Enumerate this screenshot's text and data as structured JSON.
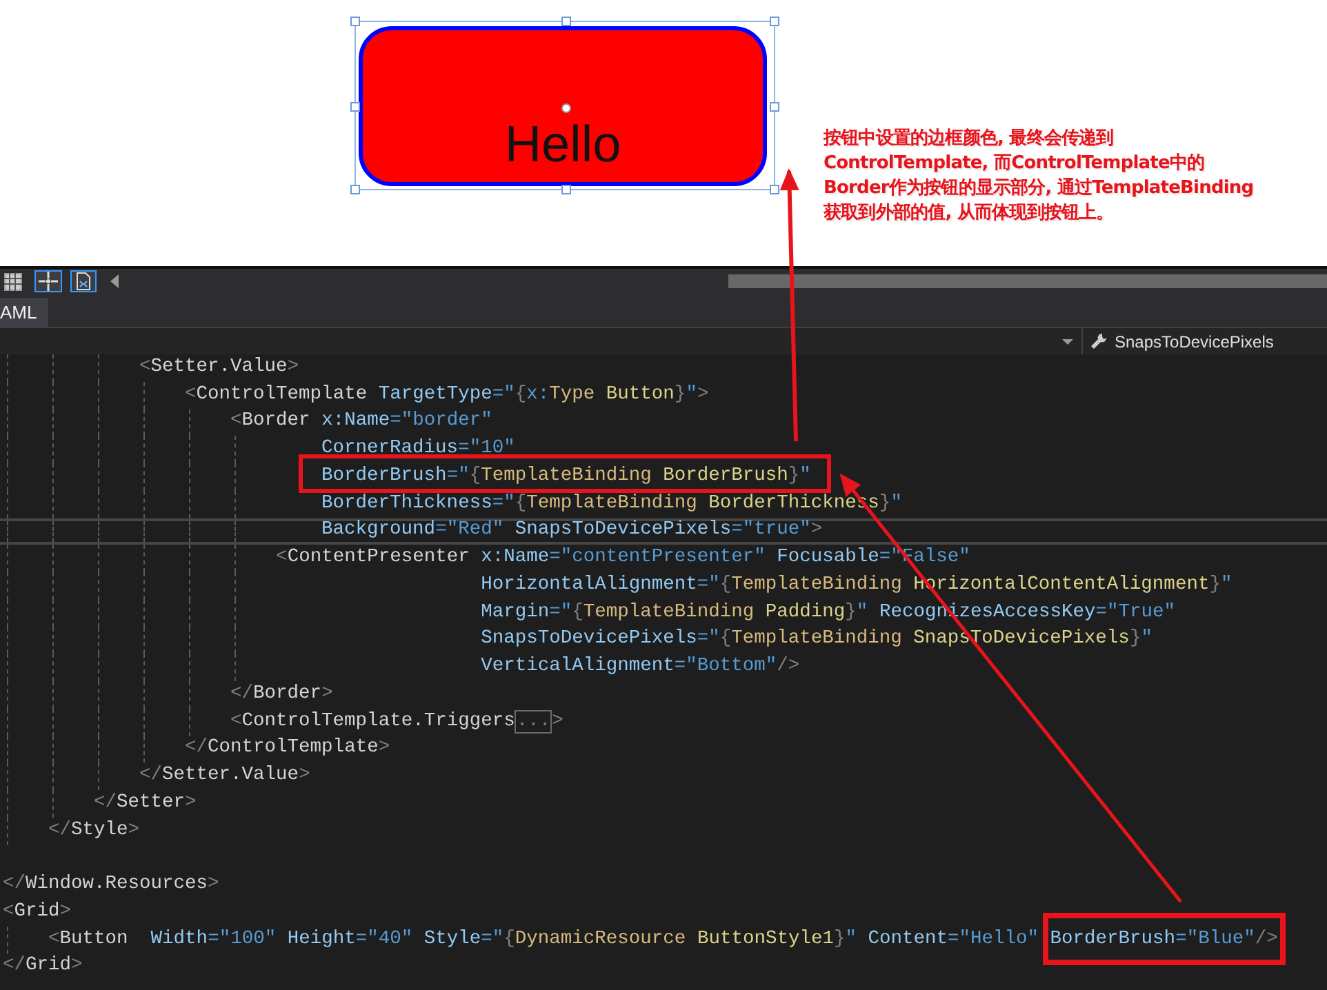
{
  "designer": {
    "button_content": "Hello",
    "note_lines": [
      "按钮中设置的边框颜色, 最终会传递到",
      "ControlTemplate, 而ControlTemplate中的",
      "Border作为按钮的显示部分, 通过TemplateBinding",
      "获取到外部的值, 从而体现到按钮上。"
    ]
  },
  "toolbar": {
    "tools": [
      {
        "kind": "grid",
        "on": false
      },
      {
        "kind": "snap",
        "on": true
      },
      {
        "kind": "page",
        "on": true
      }
    ]
  },
  "tabs": [
    {
      "label": "AML",
      "selected": true
    }
  ],
  "navbar": {
    "member": "SnapsToDevicePixels"
  },
  "code_lines": [
    {
      "kind": "code",
      "tokens": [
        {
          "kind": "punct",
          "text": "            <"
        },
        {
          "kind": "tag",
          "text": "Setter.Value"
        },
        {
          "kind": "punct",
          "text": ">"
        }
      ]
    },
    {
      "kind": "code",
      "tokens": [
        {
          "kind": "punct",
          "text": "                <"
        },
        {
          "kind": "tag",
          "text": "ControlTemplate"
        },
        {
          "kind": "attr",
          "text": " TargetType"
        },
        {
          "kind": "str",
          "text": "=\""
        },
        {
          "kind": "punct",
          "text": "{"
        },
        {
          "kind": "str",
          "text": "x:"
        },
        {
          "kind": "ext",
          "text": "Type"
        },
        {
          "kind": "arg",
          "text": " Button"
        },
        {
          "kind": "punct",
          "text": "}"
        },
        {
          "kind": "str",
          "text": "\""
        },
        {
          "kind": "punct",
          "text": ">"
        }
      ]
    },
    {
      "kind": "code",
      "tokens": [
        {
          "kind": "punct",
          "text": "                    <"
        },
        {
          "kind": "tag",
          "text": "Border"
        },
        {
          "kind": "attr",
          "text": " x:Name"
        },
        {
          "kind": "str",
          "text": "=\"border\""
        }
      ]
    },
    {
      "kind": "code",
      "tokens": [
        {
          "kind": "attr",
          "text": "                            CornerRadius"
        },
        {
          "kind": "str",
          "text": "=\"10\""
        }
      ]
    },
    {
      "kind": "code",
      "tokens": [
        {
          "kind": "attr",
          "text": "                            BorderBrush"
        },
        {
          "kind": "str",
          "text": "=\""
        },
        {
          "kind": "punct",
          "text": "{"
        },
        {
          "kind": "ext",
          "text": "TemplateBinding"
        },
        {
          "kind": "arg",
          "text": " BorderBrush"
        },
        {
          "kind": "punct",
          "text": "}"
        },
        {
          "kind": "str",
          "text": "\""
        }
      ]
    },
    {
      "kind": "code",
      "tokens": [
        {
          "kind": "attr",
          "text": "                            BorderThickness"
        },
        {
          "kind": "str",
          "text": "=\""
        },
        {
          "kind": "punct",
          "text": "{"
        },
        {
          "kind": "ext",
          "text": "TemplateBinding"
        },
        {
          "kind": "arg",
          "text": " BorderThickness"
        },
        {
          "kind": "punct",
          "text": "}"
        },
        {
          "kind": "str",
          "text": "\""
        }
      ]
    },
    {
      "kind": "current",
      "tokens": [
        {
          "kind": "attr",
          "text": "                            Background"
        },
        {
          "kind": "str",
          "text": "=\"Red\""
        },
        {
          "kind": "attr",
          "text": " SnapsToDevicePixels"
        },
        {
          "kind": "str",
          "text": "=\"true\""
        },
        {
          "kind": "punct",
          "text": ">"
        }
      ]
    },
    {
      "kind": "code",
      "tokens": [
        {
          "kind": "punct",
          "text": "                        <"
        },
        {
          "kind": "tag",
          "text": "ContentPresenter"
        },
        {
          "kind": "attr",
          "text": " x:Name"
        },
        {
          "kind": "str",
          "text": "=\"contentPresenter\""
        },
        {
          "kind": "attr",
          "text": " Focusable"
        },
        {
          "kind": "str",
          "text": "=\"False\""
        }
      ]
    },
    {
      "kind": "code",
      "tokens": [
        {
          "kind": "attr",
          "text": "                                          HorizontalAlignment"
        },
        {
          "kind": "str",
          "text": "=\""
        },
        {
          "kind": "punct",
          "text": "{"
        },
        {
          "kind": "ext",
          "text": "TemplateBinding"
        },
        {
          "kind": "arg",
          "text": " HorizontalContentAlignment"
        },
        {
          "kind": "punct",
          "text": "}"
        },
        {
          "kind": "str",
          "text": "\""
        }
      ]
    },
    {
      "kind": "code",
      "tokens": [
        {
          "kind": "attr",
          "text": "                                          Margin"
        },
        {
          "kind": "str",
          "text": "=\""
        },
        {
          "kind": "punct",
          "text": "{"
        },
        {
          "kind": "ext",
          "text": "TemplateBinding"
        },
        {
          "kind": "arg",
          "text": " Padding"
        },
        {
          "kind": "punct",
          "text": "}"
        },
        {
          "kind": "str",
          "text": "\""
        },
        {
          "kind": "attr",
          "text": " RecognizesAccessKey"
        },
        {
          "kind": "str",
          "text": "=\"True\""
        }
      ]
    },
    {
      "kind": "code",
      "tokens": [
        {
          "kind": "attr",
          "text": "                                          SnapsToDevicePixels"
        },
        {
          "kind": "str",
          "text": "=\""
        },
        {
          "kind": "punct",
          "text": "{"
        },
        {
          "kind": "ext",
          "text": "TemplateBinding"
        },
        {
          "kind": "arg",
          "text": " SnapsToDevicePixels"
        },
        {
          "kind": "punct",
          "text": "}"
        },
        {
          "kind": "str",
          "text": "\""
        }
      ]
    },
    {
      "kind": "code",
      "tokens": [
        {
          "kind": "attr",
          "text": "                                          VerticalAlignment"
        },
        {
          "kind": "str",
          "text": "=\"Bottom\""
        },
        {
          "kind": "punct",
          "text": "/>"
        }
      ]
    },
    {
      "kind": "code",
      "tokens": [
        {
          "kind": "punct",
          "text": "                    </"
        },
        {
          "kind": "tag",
          "text": "Border"
        },
        {
          "kind": "punct",
          "text": ">"
        }
      ]
    },
    {
      "kind": "code",
      "tokens": [
        {
          "kind": "punct",
          "text": "                    <"
        },
        {
          "kind": "tag",
          "text": "ControlTemplate.Triggers"
        },
        {
          "kind": "fold",
          "text": "..."
        },
        {
          "kind": "punct",
          "text": ">"
        }
      ]
    },
    {
      "kind": "code",
      "tokens": [
        {
          "kind": "punct",
          "text": "                </"
        },
        {
          "kind": "tag",
          "text": "ControlTemplate"
        },
        {
          "kind": "punct",
          "text": ">"
        }
      ]
    },
    {
      "kind": "code",
      "tokens": [
        {
          "kind": "punct",
          "text": "            </"
        },
        {
          "kind": "tag",
          "text": "Setter.Value"
        },
        {
          "kind": "punct",
          "text": ">"
        }
      ]
    },
    {
      "kind": "code",
      "tokens": [
        {
          "kind": "punct",
          "text": "        </"
        },
        {
          "kind": "tag",
          "text": "Setter"
        },
        {
          "kind": "punct",
          "text": ">"
        }
      ]
    },
    {
      "kind": "code",
      "tokens": [
        {
          "kind": "punct",
          "text": "    </"
        },
        {
          "kind": "tag",
          "text": "Style"
        },
        {
          "kind": "punct",
          "text": ">"
        }
      ]
    },
    {
      "kind": "blank"
    },
    {
      "kind": "code",
      "tokens": [
        {
          "kind": "punct",
          "text": "</"
        },
        {
          "kind": "tag",
          "text": "Window.Resources"
        },
        {
          "kind": "punct",
          "text": ">"
        }
      ]
    },
    {
      "kind": "code",
      "tokens": [
        {
          "kind": "punct",
          "text": "<"
        },
        {
          "kind": "tag",
          "text": "Grid"
        },
        {
          "kind": "punct",
          "text": ">"
        }
      ]
    },
    {
      "kind": "code",
      "tokens": [
        {
          "kind": "punct",
          "text": "    <"
        },
        {
          "kind": "tag",
          "text": "Button"
        },
        {
          "kind": "attr",
          "text": "  Width"
        },
        {
          "kind": "str",
          "text": "=\"100\""
        },
        {
          "kind": "attr",
          "text": " Height"
        },
        {
          "kind": "str",
          "text": "=\"40\""
        },
        {
          "kind": "attr",
          "text": " Style"
        },
        {
          "kind": "str",
          "text": "=\""
        },
        {
          "kind": "punct",
          "text": "{"
        },
        {
          "kind": "ext",
          "text": "DynamicResource"
        },
        {
          "kind": "arg",
          "text": " ButtonStyle1"
        },
        {
          "kind": "punct",
          "text": "}"
        },
        {
          "kind": "str",
          "text": "\""
        },
        {
          "kind": "attr",
          "text": " Content"
        },
        {
          "kind": "str",
          "text": "=\"Hello\""
        },
        {
          "kind": "attr",
          "text": " BorderBrush"
        },
        {
          "kind": "str",
          "text": "=\"Blue\""
        },
        {
          "kind": "punct",
          "text": "/>"
        }
      ]
    },
    {
      "kind": "code",
      "tokens": [
        {
          "kind": "punct",
          "text": "</"
        },
        {
          "kind": "tag",
          "text": "Grid"
        },
        {
          "kind": "punct",
          "text": ">"
        }
      ]
    }
  ]
}
